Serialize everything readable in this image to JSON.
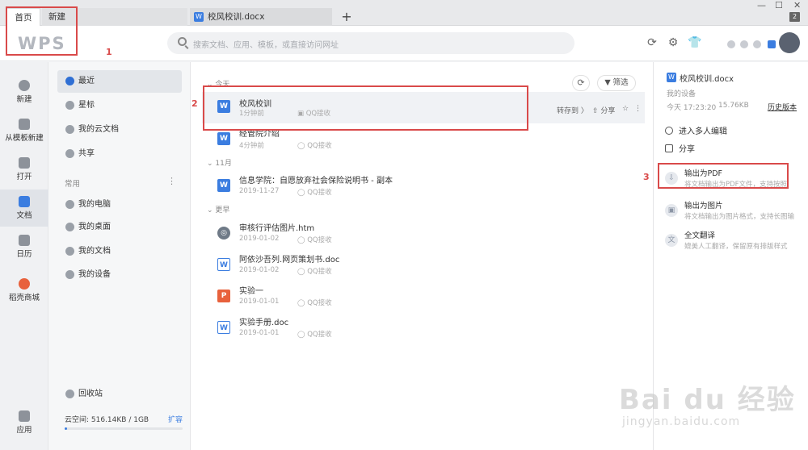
{
  "tabs": {
    "home": "首页",
    "new": "新建",
    "doc": "校风校训.docx",
    "add": "+",
    "count": "2"
  },
  "window": {
    "minimize": "—",
    "restore": "☐",
    "close": "✕"
  },
  "header": {
    "logo": "WPS",
    "search_placeholder": "搜索文档、应用、模板，或直接访问网址"
  },
  "leftnav": [
    {
      "label": "新建"
    },
    {
      "label": "从模板新建"
    },
    {
      "label": "打开"
    },
    {
      "label": "文档"
    },
    {
      "label": "日历"
    },
    {
      "label": "稻壳商城"
    },
    {
      "label": "应用"
    }
  ],
  "sidebar": {
    "items": [
      {
        "label": "最近"
      },
      {
        "label": "星标"
      },
      {
        "label": "我的云文档"
      },
      {
        "label": "共享"
      }
    ],
    "section": "常用",
    "common": [
      {
        "label": "我的电脑"
      },
      {
        "label": "我的桌面"
      },
      {
        "label": "我的文档"
      },
      {
        "label": "我的设备"
      }
    ],
    "recycle": "回收站",
    "storage": "云空间: 516.14KB / 1GB",
    "expand": "扩容"
  },
  "main": {
    "filter": "筛选",
    "groups": {
      "today": "今天",
      "nov": "11月",
      "earlier": "更早"
    },
    "files": [
      {
        "name": "校风校训",
        "time": "1分钟前",
        "src": "QQ接收",
        "icon": "W"
      },
      {
        "name": "经管院介绍",
        "time": "4分钟前",
        "src": "QQ接收",
        "icon": "W"
      },
      {
        "name": "信息学院：自愿放弃社会保险说明书 - 副本",
        "time": "2019-11-27",
        "src": "QQ接收",
        "icon": "W"
      },
      {
        "name": "审核行评估图片.htm",
        "time": "2019-01-02",
        "src": "QQ接收",
        "icon": "globe"
      },
      {
        "name": "阿依沙吾列.网页策划书.doc",
        "time": "2019-01-02",
        "src": "QQ接收",
        "icon": "W"
      },
      {
        "name": "实验一",
        "time": "2019-01-01",
        "src": "QQ接收",
        "icon": "P"
      },
      {
        "name": "实验手册.doc",
        "time": "2019-01-01",
        "src": "QQ接收",
        "icon": "W"
      }
    ],
    "row_actions": {
      "transfer": "转存到 〉",
      "share": "分享"
    }
  },
  "rpanel": {
    "filename": "校风校训.docx",
    "location": "我的设备",
    "date": "今天 17:23:20",
    "size": "15.76KB",
    "history": "历史版本",
    "edit": "进入多人编辑",
    "share": "分享",
    "pdf_title": "输出为PDF",
    "pdf_desc": "将文档输出为PDF文件，支持按照",
    "img_title": "输出为图片",
    "img_desc": "将文档输出为图片格式，支持长图输",
    "trans_title": "全文翻译",
    "trans_desc": "媲美人工翻译，保留原有排版样式"
  },
  "annotations": [
    "1",
    "2",
    "3"
  ],
  "watermark": {
    "main": "Bai du 经验",
    "sub": "jingyan.baidu.com"
  }
}
